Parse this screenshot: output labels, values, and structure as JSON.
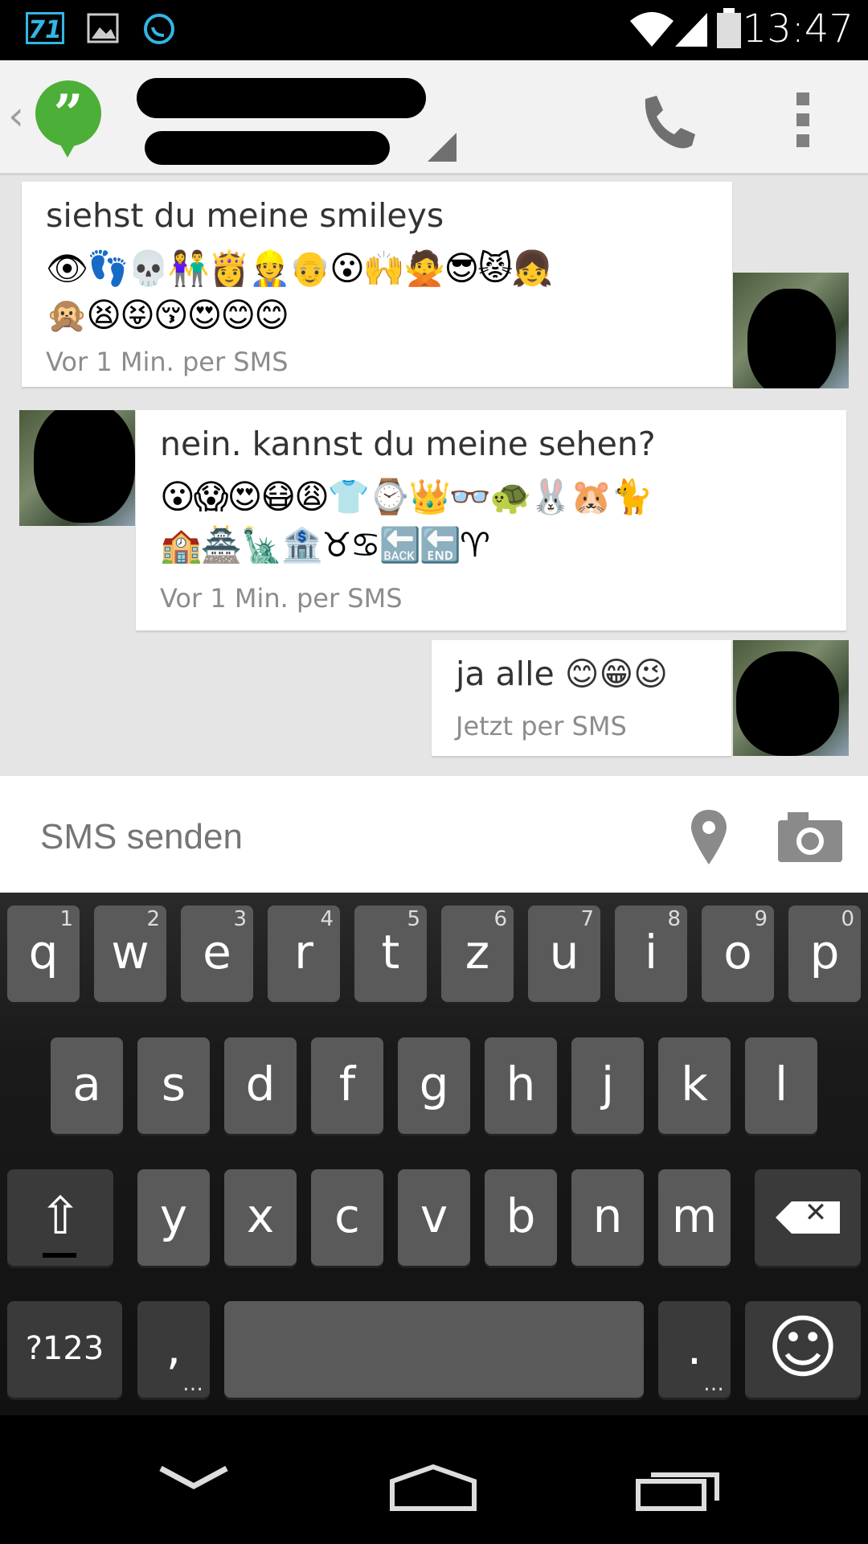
{
  "status_bar": {
    "notification_badge": "71",
    "time": "13:47"
  },
  "action_bar": {
    "back_glyph": "‹",
    "app_logo_glyph": "”"
  },
  "conversation": {
    "messages": [
      {
        "text": "siehst du meine smileys",
        "emoji_row_1": "👁👣💀👫👸👷👴😮🙌🙅😎😾👧",
        "emoji_row_2": "🙊😫😝😚😍😊😊",
        "meta": "Vor 1 Min. per SMS"
      },
      {
        "text": "nein. kannst du meine sehen?",
        "emoji_row_1": "😮😱😍😷😩👕⌚👑👓🐢🐰🐹🐈",
        "emoji_row_2": "🏫🏯🗽🏦♉♋🔙🔚♈",
        "meta": "Vor 1 Min. per SMS"
      },
      {
        "text": "ja alle 😊😁😉",
        "meta": "Jetzt per SMS"
      }
    ]
  },
  "compose": {
    "placeholder": "SMS senden"
  },
  "keyboard": {
    "row1": [
      {
        "label": "q",
        "hint": "1"
      },
      {
        "label": "w",
        "hint": "2"
      },
      {
        "label": "e",
        "hint": "3"
      },
      {
        "label": "r",
        "hint": "4"
      },
      {
        "label": "t",
        "hint": "5"
      },
      {
        "label": "z",
        "hint": "6"
      },
      {
        "label": "u",
        "hint": "7"
      },
      {
        "label": "i",
        "hint": "8"
      },
      {
        "label": "o",
        "hint": "9"
      },
      {
        "label": "p",
        "hint": "0"
      }
    ],
    "row2": [
      "a",
      "s",
      "d",
      "f",
      "g",
      "h",
      "j",
      "k",
      "l"
    ],
    "row3": [
      "y",
      "x",
      "c",
      "v",
      "b",
      "n",
      "m"
    ],
    "symbols_label": "?123",
    "comma_label": ",",
    "period_label": ".",
    "shift_glyph": "⇧",
    "delete_glyph": "✕",
    "emoji_glyph": "☺"
  },
  "colors": {
    "accent": "#33b5e5",
    "hangouts_green": "#4caf37",
    "keyboard_key": "#5a5a5a"
  }
}
